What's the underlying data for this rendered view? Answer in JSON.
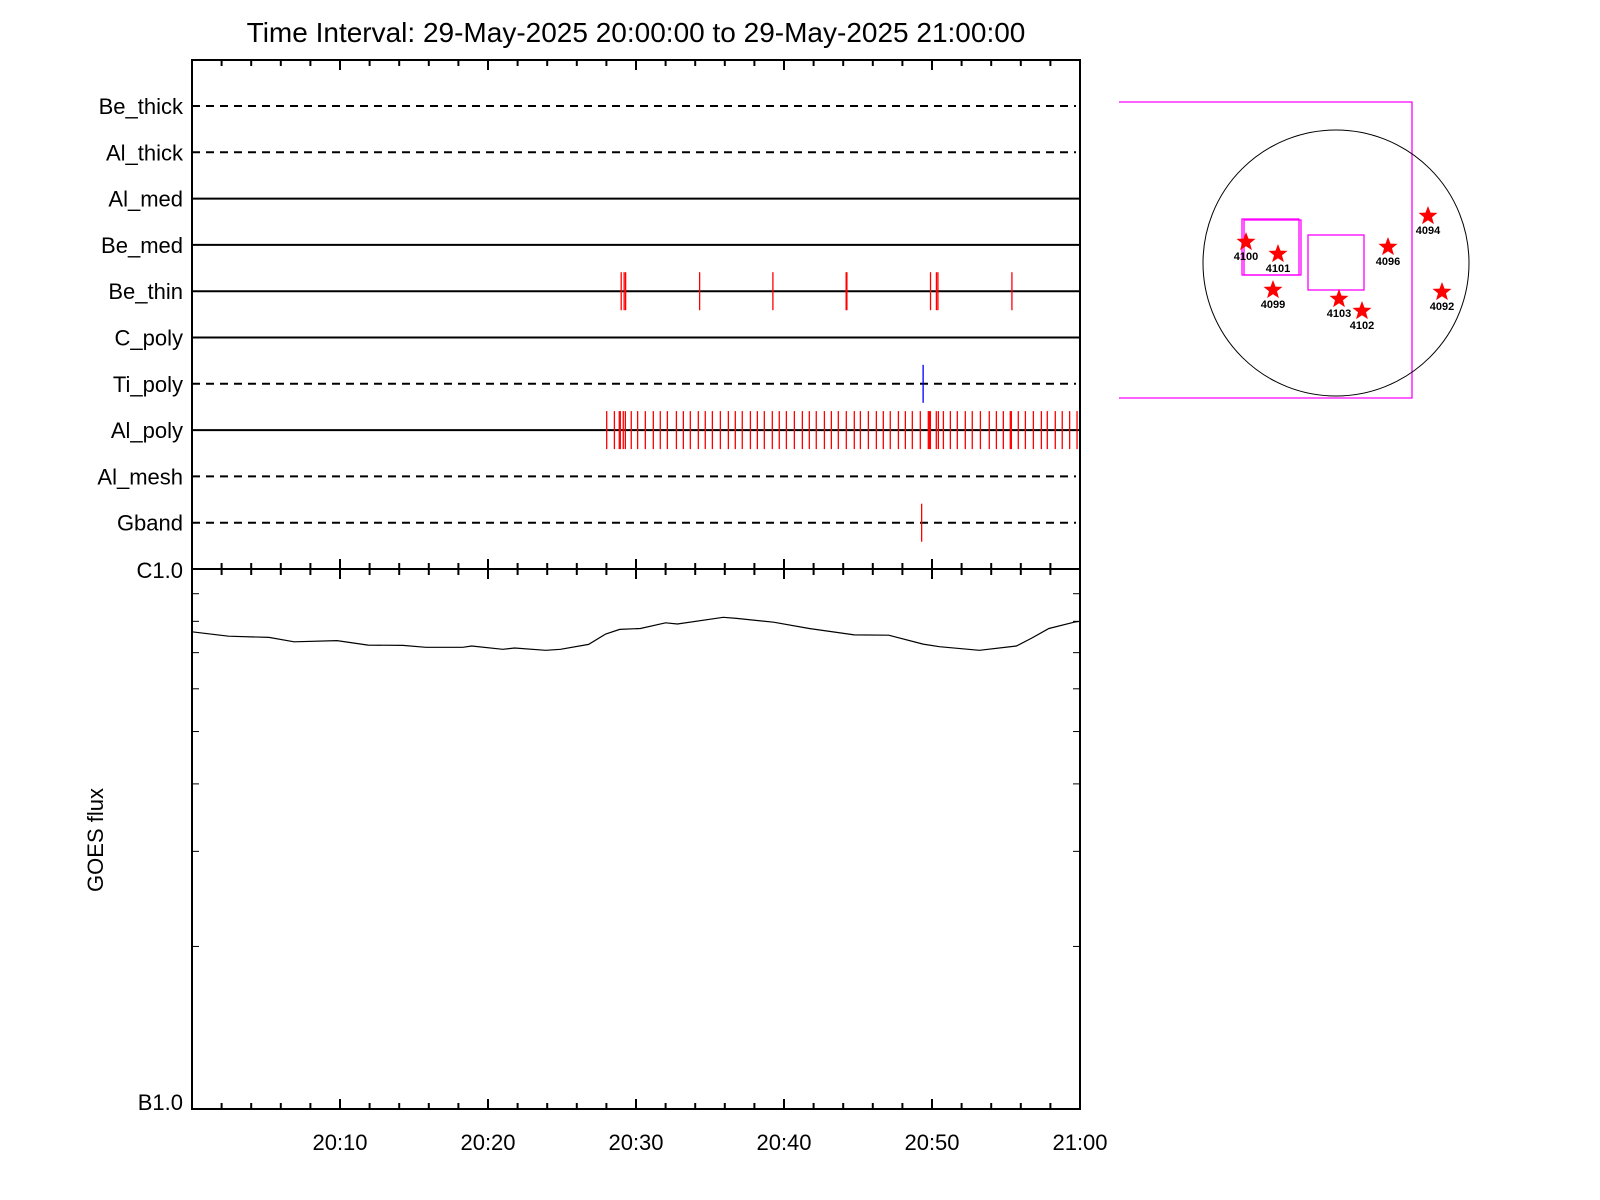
{
  "chart_data": [
    {
      "type": "timeline",
      "title": "Time Interval: 29-May-2025 20:00:00 to 29-May-2025 21:00:00",
      "x_range_minutes_after_20_00": [
        0,
        60
      ],
      "x_tick_labels": [
        "20:10",
        "20:20",
        "20:30",
        "20:40",
        "20:50",
        "21:00"
      ],
      "rows": [
        {
          "name": "Be_thick",
          "line_style": "dashed",
          "events": []
        },
        {
          "name": "Al_thick",
          "line_style": "dashed",
          "events": []
        },
        {
          "name": "Al_med",
          "line_style": "solid",
          "events": []
        },
        {
          "name": "Be_med",
          "line_style": "solid",
          "events": []
        },
        {
          "name": "Be_thin",
          "line_style": "solid",
          "color": "#ff0000",
          "events": [
            29.0,
            29.2,
            29.3,
            34.3,
            39.25,
            44.2,
            44.25,
            49.9,
            50.3,
            50.4,
            55.4
          ]
        },
        {
          "name": "C_poly",
          "line_style": "solid",
          "events": []
        },
        {
          "name": "Ti_poly",
          "line_style": "dashed",
          "color": "#0000ff",
          "events": [
            49.4
          ]
        },
        {
          "name": "Al_poly",
          "line_style": "solid",
          "color": "#ff0000",
          "events": [
            28.02,
            28.54,
            28.87,
            28.94,
            29.14,
            29.28,
            29.68,
            30.11,
            30.63,
            31.17,
            31.64,
            32.12,
            32.73,
            33.2,
            33.67,
            34.21,
            34.68,
            35.16,
            35.7,
            36.24,
            36.71,
            37.18,
            37.73,
            38.2,
            38.67,
            39.21,
            39.68,
            40.16,
            40.7,
            41.24,
            41.71,
            42.18,
            42.73,
            43.2,
            43.67,
            44.21,
            44.75,
            45.16,
            45.7,
            46.24,
            46.71,
            47.18,
            47.73,
            48.2,
            48.67,
            49.21,
            49.75,
            49.82,
            49.89,
            50.29,
            50.43,
            50.77,
            51.24,
            51.71,
            52.25,
            52.72,
            53.27,
            53.87,
            54.35,
            54.82,
            55.29,
            55.36,
            55.83,
            56.31,
            56.85,
            57.39,
            57.79,
            58.33,
            58.8,
            59.3,
            59.8
          ]
        },
        {
          "name": "Al_mesh",
          "line_style": "dashed",
          "events": []
        },
        {
          "name": "Gband",
          "line_style": "dashed",
          "color": "#ff0000",
          "events": [
            49.3
          ]
        }
      ]
    },
    {
      "type": "line",
      "ylabel": "GOES flux",
      "y_scale": "log",
      "ylim": [
        1e-07,
        1e-06
      ],
      "y_tick_labels": [
        "C1.0",
        "B1.0"
      ],
      "x_tick_labels": [
        "20:10",
        "20:20",
        "20:30",
        "20:40",
        "20:50",
        "21:00"
      ],
      "x_minutes": [
        0,
        2.47,
        5.2,
        6.9,
        9.8,
        11.9,
        14.25,
        15.8,
        18.3,
        18.9,
        21.0,
        21.8,
        23.9,
        24.9,
        26.8,
        27.95,
        28.9,
        30.3,
        32.0,
        32.8,
        35.9,
        36.8,
        39.3,
        41.7,
        44.75,
        47.07,
        49.4,
        50.5,
        53.2,
        55.7,
        56.7,
        57.9,
        59.6,
        60
      ],
      "values": [
        7.65e-07,
        7.51e-07,
        7.47e-07,
        7.33e-07,
        7.37e-07,
        7.23e-07,
        7.22e-07,
        7.16e-07,
        7.16e-07,
        7.2e-07,
        7.1e-07,
        7.14e-07,
        7.07e-07,
        7.1e-07,
        7.25e-07,
        7.58e-07,
        7.73e-07,
        7.76e-07,
        7.95e-07,
        7.91e-07,
        8.14e-07,
        8.1e-07,
        7.97e-07,
        7.76e-07,
        7.55e-07,
        7.54e-07,
        7.26e-07,
        7.18e-07,
        7.07e-07,
        7.2e-07,
        7.44e-07,
        7.76e-07,
        7.97e-07,
        8e-07
      ],
      "color": "#000000"
    },
    {
      "type": "map",
      "active_regions": [
        "4100",
        "4101",
        "4099",
        "4103",
        "4102",
        "4096",
        "4094",
        "4092"
      ],
      "star_color": "#ff0000",
      "box_color": "#ff00ff"
    }
  ]
}
